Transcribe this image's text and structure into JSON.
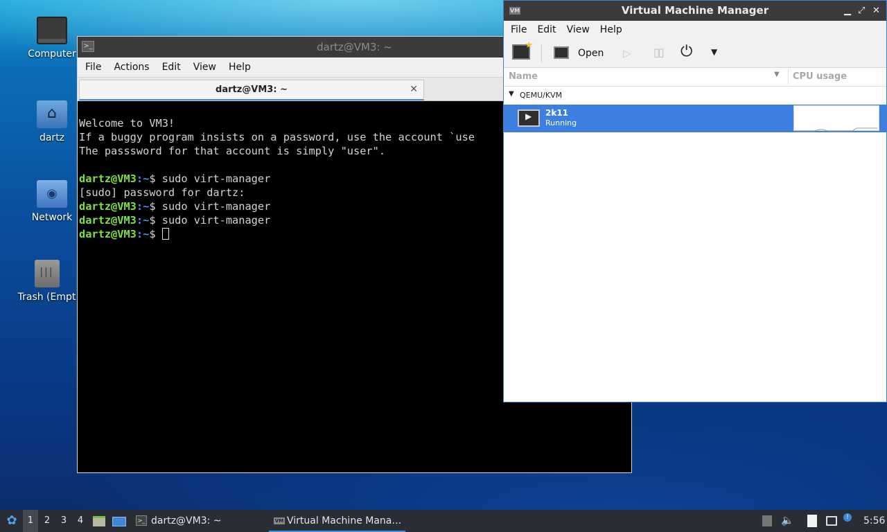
{
  "desktop": {
    "icons": [
      {
        "label": "Computer"
      },
      {
        "label": "dartz"
      },
      {
        "label": "Network"
      },
      {
        "label": "Trash (Empt"
      }
    ]
  },
  "terminal": {
    "title": "dartz@VM3: ~",
    "menu": [
      "File",
      "Actions",
      "Edit",
      "View",
      "Help"
    ],
    "tab_label": "dartz@VM3: ~",
    "lines": [
      {
        "text": "Welcome to VM3!"
      },
      {
        "text": "If a buggy program insists on a password, use the account `use"
      },
      {
        "text": "The passsword for that account is simply \"user\"."
      },
      {
        "text": ""
      },
      {
        "user": "dartz@VM3",
        "path": ":~",
        "cmd": "$ sudo virt-manager"
      },
      {
        "text": "[sudo] password for dartz:"
      },
      {
        "user": "dartz@VM3",
        "path": ":~",
        "cmd": "$ sudo virt-manager"
      },
      {
        "user": "dartz@VM3",
        "path": ":~",
        "cmd": "$ sudo virt-manager"
      },
      {
        "user": "dartz@VM3",
        "path": ":~",
        "cmd": "$ ",
        "cursor": true
      }
    ]
  },
  "vmm": {
    "title": "Virtual Machine Manager",
    "menu": [
      "File",
      "Edit",
      "View",
      "Help"
    ],
    "toolbar": {
      "open_label": "Open"
    },
    "columns": {
      "name": "Name",
      "cpu": "CPU usage"
    },
    "group": "QEMU/KVM",
    "vm": {
      "name": "2k11",
      "status": "Running"
    }
  },
  "taskbar": {
    "workspaces": [
      "1",
      "2",
      "3",
      "4"
    ],
    "active_workspace": "1",
    "tasks": [
      {
        "label": "dartz@VM3: ~"
      },
      {
        "label": "Virtual Machine Mana…"
      }
    ],
    "clock": "5:56"
  },
  "colors": {
    "accent": "#3d7fe0",
    "prompt_user": "#7fe23f",
    "prompt_path": "#5a8ff0"
  }
}
